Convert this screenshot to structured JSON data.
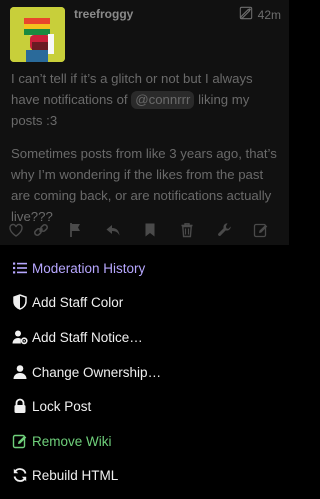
{
  "post": {
    "username": "treefroggy",
    "time": "42m",
    "body_before_mention": "I can’t tell if it’s a glitch or not but I always have notifications of ",
    "mention": "@connrrr",
    "body_after_mention": " liking my posts :3",
    "body_paragraph_2": "Sometimes posts from like 3 years ago, that’s why I’m wondering if the likes from the past are coming back, or are notifications actually live???"
  },
  "actions": {
    "icons": [
      "heart-icon",
      "link-icon",
      "flag-icon",
      "reply-icon",
      "bookmark-icon",
      "trash-icon",
      "wrench-icon",
      "edit-icon"
    ]
  },
  "menu": {
    "items": [
      {
        "label": "Moderation History",
        "icon": "list-icon",
        "color": "#b7a7ff"
      },
      {
        "label": "Add Staff Color",
        "icon": "shield-icon",
        "color": "#f0f0f0"
      },
      {
        "label": "Add Staff Notice…",
        "icon": "user-gear-icon",
        "color": "#f0f0f0"
      },
      {
        "label": "Change Ownership…",
        "icon": "user-icon",
        "color": "#f0f0f0"
      },
      {
        "label": "Lock Post",
        "icon": "lock-icon",
        "color": "#f0f0f0"
      },
      {
        "label": "Remove Wiki",
        "icon": "edit-icon",
        "color": "#6fd07b"
      },
      {
        "label": "Rebuild HTML",
        "icon": "refresh-icon",
        "color": "#f0f0f0"
      }
    ]
  }
}
